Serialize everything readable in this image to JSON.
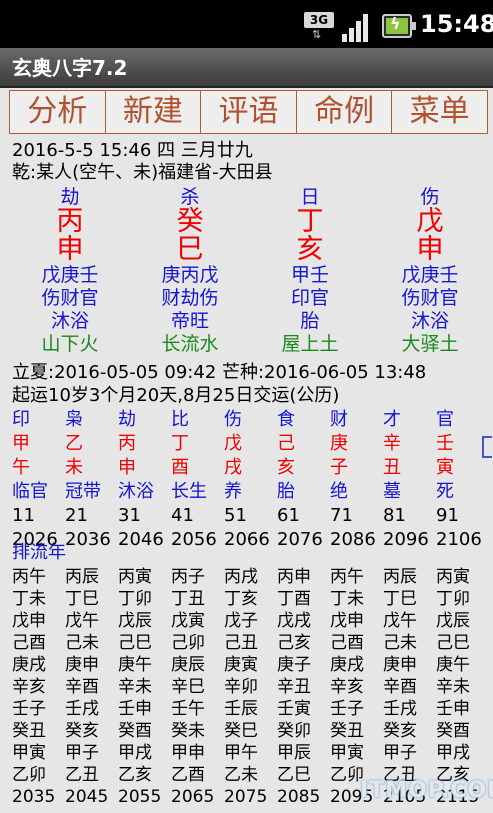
{
  "status_bar": {
    "network": "3G",
    "time": "15:48"
  },
  "app_title": "玄奥八字7.2",
  "menu": [
    "分析",
    "新建",
    "评语",
    "命例",
    "菜单"
  ],
  "info": {
    "date_line": "2016-5-5 15:46  四  三月廿九",
    "person_line": "乾:某人(空午、未)福建省-大田县"
  },
  "pillars": [
    {
      "god": "劫",
      "stem": "丙",
      "branch": "申",
      "hidden": "戊庚壬",
      "hidden_gods": "伤财官",
      "stage": "沐浴",
      "nayin": "山下火"
    },
    {
      "god": "杀",
      "stem": "癸",
      "branch": "巳",
      "hidden": "庚丙戊",
      "hidden_gods": "财劫伤",
      "stage": "帝旺",
      "nayin": "长流水"
    },
    {
      "god": "日",
      "stem": "丁",
      "branch": "亥",
      "hidden": "甲壬",
      "hidden_gods": "印官",
      "stage": "胎",
      "nayin": "屋上土"
    },
    {
      "god": "伤",
      "stem": "戊",
      "branch": "申",
      "hidden": "戊庚壬",
      "hidden_gods": "伤财官",
      "stage": "沐浴",
      "nayin": "大驿土"
    }
  ],
  "solar_terms": "立夏:2016-05-05 09:42  芒种:2016-06-05 13:48",
  "luck_start": "起运10岁3个月20天,8月25日交运(公历)",
  "da_yun": [
    {
      "god": "印",
      "stem": "甲",
      "branch": "午",
      "stage": "临官",
      "age": "11",
      "year": "2026"
    },
    {
      "god": "枭",
      "stem": "乙",
      "branch": "未",
      "stage": "冠带",
      "age": "21",
      "year": "2036"
    },
    {
      "god": "劫",
      "stem": "丙",
      "branch": "申",
      "stage": "沐浴",
      "age": "31",
      "year": "2046"
    },
    {
      "god": "比",
      "stem": "丁",
      "branch": "酉",
      "stage": "长生",
      "age": "41",
      "year": "2056"
    },
    {
      "god": "伤",
      "stem": "戊",
      "branch": "戌",
      "stage": "养",
      "age": "51",
      "year": "2066"
    },
    {
      "god": "食",
      "stem": "己",
      "branch": "亥",
      "stage": "胎",
      "age": "61",
      "year": "2076"
    },
    {
      "god": "财",
      "stem": "庚",
      "branch": "子",
      "stage": "绝",
      "age": "71",
      "year": "2086"
    },
    {
      "god": "才",
      "stem": "辛",
      "branch": "丑",
      "stage": "墓",
      "age": "81",
      "year": "2096"
    },
    {
      "god": "官",
      "stem": "壬",
      "branch": "寅",
      "stage": "死",
      "age": "91",
      "year": "2106"
    }
  ],
  "liu_nian_label": "排流年",
  "liu_nian": [
    [
      "丙午",
      "丁未",
      "戊申",
      "己酉",
      "庚戌",
      "辛亥",
      "壬子",
      "癸丑",
      "甲寅",
      "乙卯",
      "2035"
    ],
    [
      "丙辰",
      "丁巳",
      "戊午",
      "己未",
      "庚申",
      "辛酉",
      "壬戌",
      "癸亥",
      "甲子",
      "乙丑",
      "2045"
    ],
    [
      "丙寅",
      "丁卯",
      "戊辰",
      "己巳",
      "庚午",
      "辛未",
      "壬申",
      "癸酉",
      "甲戌",
      "乙亥",
      "2055"
    ],
    [
      "丙子",
      "丁丑",
      "戊寅",
      "己卯",
      "庚辰",
      "辛巳",
      "壬午",
      "癸未",
      "甲申",
      "乙酉",
      "2065"
    ],
    [
      "丙戌",
      "丁亥",
      "戊子",
      "己丑",
      "庚寅",
      "辛卯",
      "壬辰",
      "癸巳",
      "甲午",
      "乙未",
      "2075"
    ],
    [
      "丙申",
      "丁酉",
      "戊戌",
      "己亥",
      "庚子",
      "辛丑",
      "壬寅",
      "癸卯",
      "甲辰",
      "乙巳",
      "2085"
    ],
    [
      "丙午",
      "丁未",
      "戊申",
      "己酉",
      "庚戌",
      "辛亥",
      "壬子",
      "癸丑",
      "甲寅",
      "乙卯",
      "2095"
    ],
    [
      "丙辰",
      "丁巳",
      "戊午",
      "己未",
      "庚申",
      "辛酉",
      "壬戌",
      "癸亥",
      "甲子",
      "乙丑",
      "2105"
    ],
    [
      "丙寅",
      "丁卯",
      "戊辰",
      "己巳",
      "庚午",
      "辛未",
      "壬申",
      "癸酉",
      "甲戌",
      "乙亥",
      "2115"
    ]
  ],
  "watermark": "ITMOP.COM"
}
